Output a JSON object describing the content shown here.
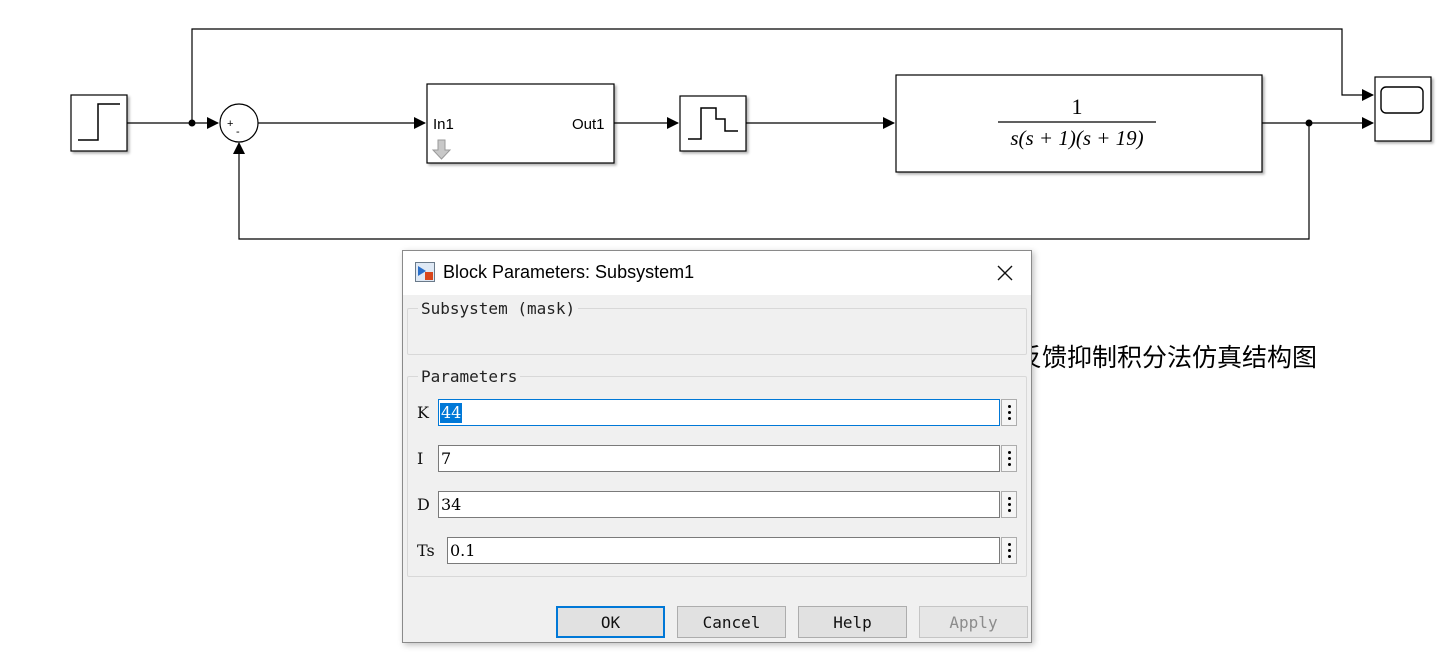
{
  "diagram": {
    "subsystem": {
      "in_port": "In1",
      "out_port": "Out1"
    },
    "sum": {
      "signs": [
        "+",
        "-"
      ]
    },
    "transfer_function": {
      "numerator": "1",
      "denominator": "s(s + 1)(s + 19)"
    }
  },
  "caption": "图2-17 反馈抑制积分法仿真结构图",
  "dialog": {
    "title": "Block Parameters: Subsystem1",
    "mask_group_label": "Subsystem (mask)",
    "params_group_label": "Parameters",
    "params": [
      {
        "label": "K",
        "value": "44"
      },
      {
        "label": "I",
        "value": "7"
      },
      {
        "label": "D",
        "value": "34"
      },
      {
        "label": "Ts",
        "value": "0.1"
      }
    ],
    "buttons": {
      "ok": "OK",
      "cancel": "Cancel",
      "help": "Help",
      "apply": "Apply"
    }
  }
}
